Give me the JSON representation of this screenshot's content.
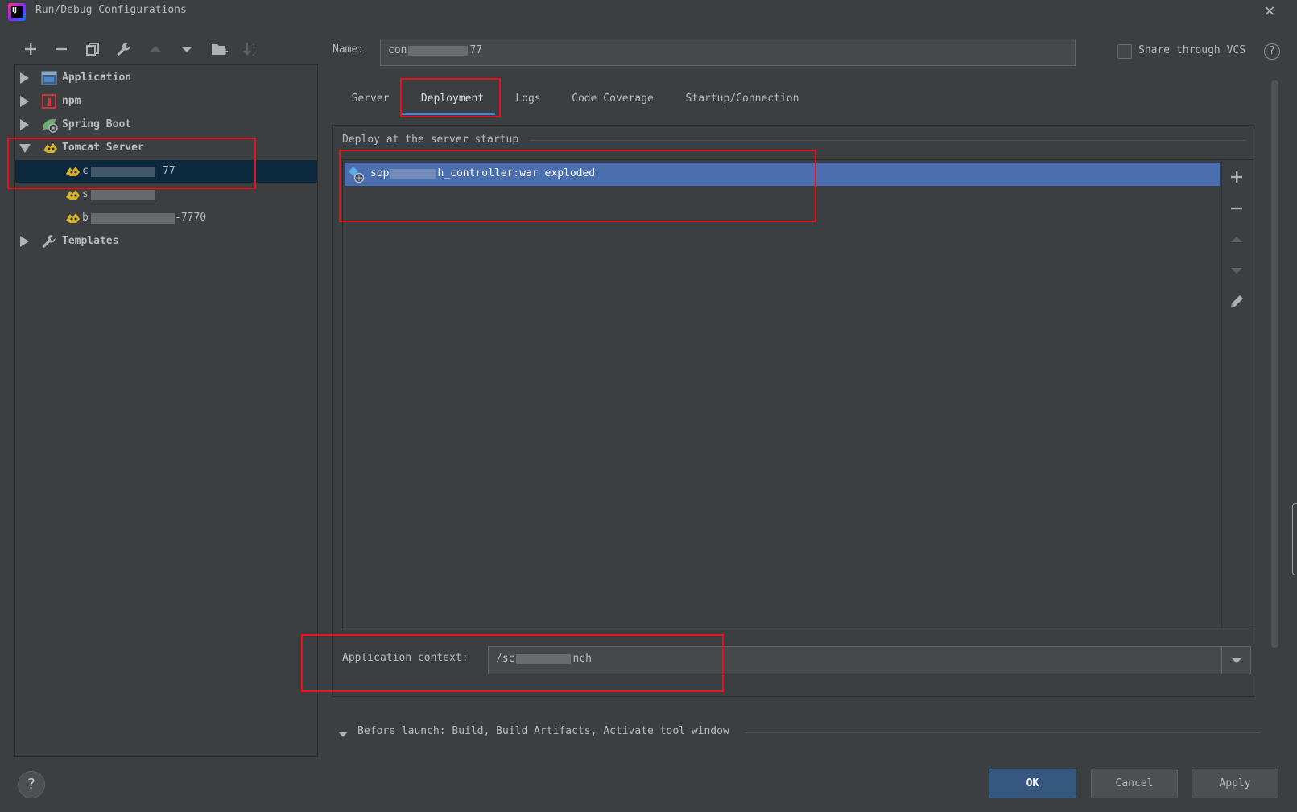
{
  "window": {
    "title": "Run/Debug Configurations",
    "logo_text": "IJ"
  },
  "toolbar": {
    "icons": [
      "add-icon",
      "remove-icon",
      "copy-icon",
      "wrench-icon",
      "move-up-icon",
      "move-down-icon",
      "new-folder-icon",
      "sort-icon"
    ]
  },
  "tree": {
    "items": [
      {
        "label": "Application",
        "icon": "application-icon",
        "expanded": false
      },
      {
        "label": "npm",
        "icon": "npm-icon",
        "expanded": false
      },
      {
        "label": "Spring Boot",
        "icon": "spring-boot-icon",
        "expanded": false
      },
      {
        "label": "Tomcat Server",
        "icon": "tomcat-icon",
        "expanded": true
      },
      {
        "label": "Templates",
        "icon": "wrench-icon",
        "expanded": false
      }
    ],
    "tomcat_children": [
      {
        "prefix": "c",
        "suffix": "77",
        "selected": true
      },
      {
        "prefix": "s",
        "suffix": "",
        "selected": false
      },
      {
        "prefix": "b",
        "suffix": "-7770",
        "selected": false
      }
    ]
  },
  "form": {
    "name_label": "Name:",
    "name_prefix": "con",
    "name_suffix": "77",
    "share_label": "Share through VCS",
    "share_checked": false,
    "help": "?"
  },
  "tabs": [
    {
      "label": "Server",
      "active": false
    },
    {
      "label": "Deployment",
      "active": true
    },
    {
      "label": "Logs",
      "active": false
    },
    {
      "label": "Code Coverage",
      "active": false
    },
    {
      "label": "Startup/Connection",
      "active": false
    }
  ],
  "deployment": {
    "section_label": "Deploy at the server startup",
    "artifact_prefix": "sop",
    "artifact_suffix": "h_controller:war exploded",
    "side_buttons": [
      "add-icon",
      "remove-icon",
      "move-up-icon",
      "move-down-icon",
      "edit-icon"
    ]
  },
  "context": {
    "label": "Application context:",
    "prefix": "/sc",
    "suffix": "nch"
  },
  "before_launch": {
    "label": "Before launch: Build, Build Artifacts, Activate tool window"
  },
  "buttons": {
    "ok": "OK",
    "cancel": "Cancel",
    "apply": "Apply",
    "help": "?"
  },
  "colors": {
    "background": "#3c3f41",
    "selection": "#4b6eaf",
    "tree_selection": "#0d293e",
    "highlight_box": "#e6131d",
    "primary_button": "#365880"
  }
}
